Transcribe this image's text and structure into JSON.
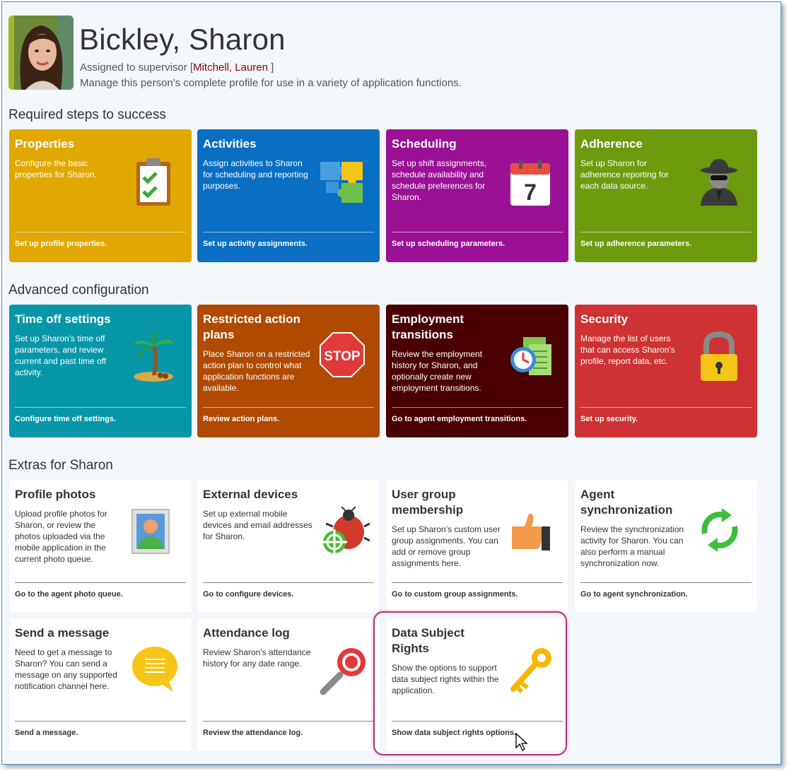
{
  "profile": {
    "name": "Bickley, Sharon",
    "supervisor_prefix": "Assigned to supervisor [",
    "supervisor_name": "Mitchell, Lauren",
    "supervisor_suffix": " ]",
    "description": "Manage this person's complete profile for use in a variety of application functions."
  },
  "sections": {
    "required": "Required steps to success",
    "advanced": "Advanced configuration",
    "extras": "Extras for Sharon"
  },
  "tiles": {
    "properties": {
      "title": "Properties",
      "desc": "Configure the basic properties for Sharon.",
      "link": "Set up profile properties.",
      "icon": "clipboard-check-icon",
      "color": "#e0a800"
    },
    "activities": {
      "title": "Activities",
      "desc": "Assign activities to Sharon for scheduling and reporting purposes.",
      "link": "Set up activity assignments.",
      "icon": "puzzle-icon",
      "color": "#0a6fc2"
    },
    "scheduling": {
      "title": "Scheduling",
      "desc": "Set up shift assignments, schedule availability and schedule preferences for Sharon.",
      "link": "Set up scheduling parameters.",
      "icon": "calendar-icon",
      "calendar_day": "7",
      "color": "#9b1196"
    },
    "adherence": {
      "title": "Adherence",
      "desc": "Set up Sharon for adherence reporting for each data source.",
      "link": "Set up adherence parameters.",
      "icon": "spy-icon",
      "color": "#6e9a0e"
    },
    "timeoff": {
      "title": "Time off settings",
      "desc": "Set up Sharon's time off parameters, and review current and past time off activity.",
      "link": "Configure time off settings.",
      "icon": "palm-tree-icon",
      "color": "#0797a8"
    },
    "restricted": {
      "title": "Restricted action plans",
      "desc": "Place Sharon on a restricted action plan to control what application functions are available.",
      "link": "Review action plans.",
      "icon": "stop-sign-icon",
      "icon_text": "STOP",
      "color": "#b04a00"
    },
    "employment": {
      "title": "Employment transitions",
      "desc": "Review the employment history for Sharon, and optionally create new employment transitions.",
      "link": "Go to agent employment transitions.",
      "icon": "clock-document-icon",
      "color": "#4a0003"
    },
    "security": {
      "title": "Security",
      "desc": "Manage the list of users that can access Sharon's profile, report data, etc.",
      "link": "Set up security.",
      "icon": "padlock-icon",
      "color": "#cf3232"
    },
    "photos": {
      "title": "Profile photos",
      "desc": "Upload profile photos for Sharon, or review the photos uploaded via the mobile application in the current photo queue.",
      "link": "Go to the agent photo queue.",
      "icon": "portrait-icon"
    },
    "devices": {
      "title": "External devices",
      "desc": "Set up external mobile devices and email addresses for Sharon.",
      "link": "Go to configure devices.",
      "icon": "bug-target-icon"
    },
    "usergroup": {
      "title": "User group membership",
      "desc": "Set up Sharon's custom user group assignments. You can add or remove group assignments here.",
      "link": "Go to custom group assignments.",
      "icon": "thumbs-up-icon"
    },
    "sync": {
      "title": "Agent synchronization",
      "desc": "Review the synchronization activity for Sharon. You can also perform a manual synchronization now.",
      "link": "Go to agent synchronization.",
      "icon": "sync-arrows-icon"
    },
    "message": {
      "title": "Send a message",
      "desc": "Need to get a message to Sharon? You can send a message on any supported notification channel here.",
      "link": "Send a message.",
      "icon": "speech-bubble-icon"
    },
    "attendance": {
      "title": "Attendance log",
      "desc": "Review Sharon's attendance history for any date range.",
      "link": "Review the attendance log.",
      "icon": "magnifier-icon"
    },
    "dsr": {
      "title": "Data Subject Rights",
      "desc": "Show the options to support data subject rights within the application.",
      "link": "Show data subject rights options.",
      "icon": "key-icon"
    }
  },
  "colors": {
    "highlight": "#b5307a",
    "supervisor_link": "#8b0000"
  }
}
